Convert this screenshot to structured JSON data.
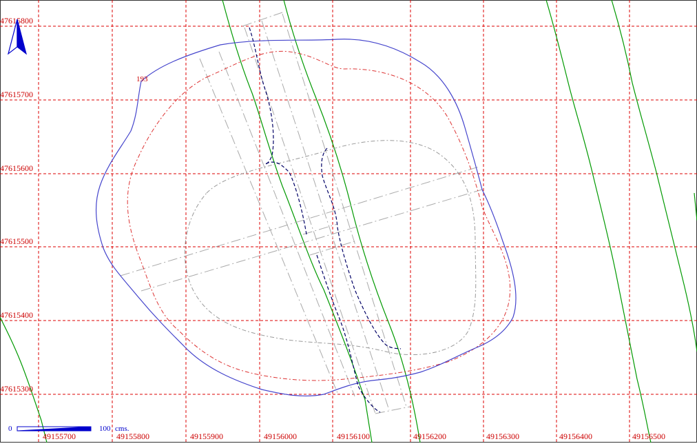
{
  "map": {
    "label_color": "#cc0000",
    "grid_color": "#dd0000",
    "x_labels": [
      "49155700",
      "49155800",
      "49155900",
      "49156000",
      "49156100",
      "49156200",
      "49156300",
      "49156400",
      "49156500"
    ],
    "y_labels": [
      "47615800",
      "47615700",
      "47615600",
      "47615500",
      "47615400",
      "47615300"
    ],
    "feature_label": "193",
    "north_arrow": {
      "icon": "north-arrow-icon",
      "color": "#0000cc"
    },
    "scale_bar": {
      "start": "0",
      "end": "100",
      "unit": "cms.",
      "color": "#0000cc"
    },
    "colors": {
      "boundary": "#4444cc",
      "inner_offset": "#dd3333",
      "inner_gray": "#999999",
      "road_lines": "#aaaaaa",
      "dark_path": "#000066",
      "green_lines": "#009900"
    }
  }
}
